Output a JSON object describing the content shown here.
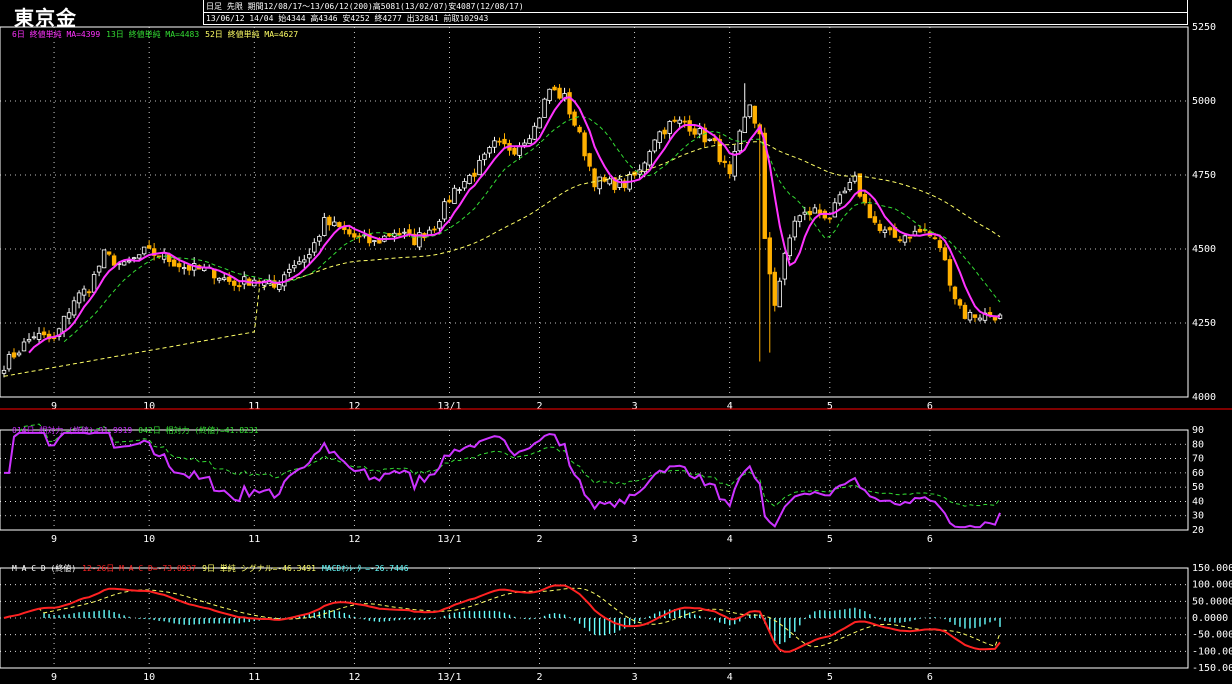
{
  "header": {
    "title": "東京金",
    "info_line1": "日足 先限 期間12/08/17～13/06/12(200)高5081(13/02/07)安4087(12/08/17)",
    "info_line2": "13/06/12 14/04 始4344 高4346 安4252 終4277 出32841 前取102943"
  },
  "colors": {
    "background": "#000000",
    "candle_up": "#ffffff",
    "candle_down": "#ffb000",
    "ma6": "#ff33ff",
    "ma13": "#33dd33",
    "ma52": "#ffff66",
    "rsi14": "#cc33ff",
    "rsi42": "#33dd33",
    "macd": "#ff2222",
    "signal": "#ffff66",
    "oscillator": "#66ffff",
    "grid": "#ffffff",
    "separator": "#ff0000"
  },
  "legends": {
    "price": [
      {
        "text": "6日 終値単純 MA=4399",
        "color": "#ff33ff"
      },
      {
        "text": "13日 終値単純 MA=4483",
        "color": "#33dd33"
      },
      {
        "text": "52日 終値単純 MA=4627",
        "color": "#ffff66"
      }
    ],
    "rsi": [
      {
        "text": "014日 相対力 (終値)=31.9919",
        "color": "#cc33ff"
      },
      {
        "text": "042日 相対力 (終値)=41.8231",
        "color": "#33dd33"
      }
    ],
    "macd": [
      {
        "text": "M A C D (終値)",
        "color": "#ffffff"
      },
      {
        "text": "12-26日 M A C D=-73.0937",
        "color": "#ff2222"
      },
      {
        "text": "9日 単純 シグナル=-46.3491",
        "color": "#ffff66"
      },
      {
        "text": "MACDｵｼﾚｰﾀｰ=-26.7446",
        "color": "#66ffff"
      }
    ]
  },
  "chart_data": [
    {
      "type": "candlestick",
      "title": "東京金",
      "ylim": [
        4000,
        5250
      ],
      "y_ticks": [
        4000,
        4250,
        4500,
        4750,
        5000,
        5250
      ],
      "y_tick_labels": [
        "4000",
        "4250",
        "4500",
        "4750",
        "5000",
        "5250"
      ],
      "x_tick_labels": [
        "9",
        "10",
        "11",
        "12",
        "13/1",
        "2",
        "3",
        "4",
        "5",
        "6"
      ],
      "x_tick_index": [
        10,
        29,
        50,
        70,
        89,
        107,
        126,
        145,
        165,
        185
      ],
      "grid": true,
      "n_days": 200,
      "close_keypoints": [
        [
          0,
          4110
        ],
        [
          6,
          4210
        ],
        [
          10,
          4190
        ],
        [
          14,
          4330
        ],
        [
          17,
          4370
        ],
        [
          20,
          4480
        ],
        [
          24,
          4440
        ],
        [
          28,
          4490
        ],
        [
          31,
          4480
        ],
        [
          36,
          4440
        ],
        [
          42,
          4420
        ],
        [
          46,
          4380
        ],
        [
          50,
          4400
        ],
        [
          54,
          4370
        ],
        [
          57,
          4440
        ],
        [
          61,
          4480
        ],
        [
          64,
          4590
        ],
        [
          67,
          4570
        ],
        [
          70,
          4540
        ],
        [
          74,
          4520
        ],
        [
          78,
          4560
        ],
        [
          82,
          4530
        ],
        [
          86,
          4580
        ],
        [
          90,
          4700
        ],
        [
          94,
          4760
        ],
        [
          98,
          4850
        ],
        [
          102,
          4840
        ],
        [
          106,
          4910
        ],
        [
          109,
          5040
        ],
        [
          112,
          5010
        ],
        [
          115,
          4880
        ],
        [
          118,
          4730
        ],
        [
          121,
          4720
        ],
        [
          124,
          4720
        ],
        [
          127,
          4760
        ],
        [
          130,
          4880
        ],
        [
          133,
          4920
        ],
        [
          136,
          4930
        ],
        [
          139,
          4890
        ],
        [
          142,
          4850
        ],
        [
          145,
          4740
        ],
        [
          147,
          4880
        ],
        [
          149,
          4990
        ],
        [
          151,
          4880
        ],
        [
          152,
          4520
        ],
        [
          154,
          4320
        ],
        [
          156,
          4470
        ],
        [
          158,
          4600
        ],
        [
          162,
          4630
        ],
        [
          165,
          4610
        ],
        [
          168,
          4690
        ],
        [
          170,
          4730
        ],
        [
          172,
          4650
        ],
        [
          175,
          4560
        ],
        [
          178,
          4540
        ],
        [
          181,
          4550
        ],
        [
          184,
          4560
        ],
        [
          187,
          4510
        ],
        [
          190,
          4340
        ],
        [
          192,
          4277
        ]
      ],
      "final_close": 4277,
      "ma_values": {
        "ma6": 4399,
        "ma13": 4483,
        "ma52": 4627
      }
    },
    {
      "type": "line",
      "title": "相対力",
      "ylim": [
        20,
        90
      ],
      "y_ticks": [
        20,
        30,
        40,
        50,
        60,
        70,
        80,
        90
      ],
      "y_tick_labels": [
        "20",
        "30",
        "40",
        "50",
        "60",
        "70",
        "80",
        "90"
      ],
      "x_tick_labels": [
        "9",
        "10",
        "11",
        "12",
        "13/1",
        "2",
        "3",
        "4",
        "5",
        "6"
      ],
      "series": [
        {
          "name": "014日 相対力 (終値)",
          "final": 31.9919
        },
        {
          "name": "042日 相対力 (終値)",
          "final": 41.8231
        }
      ]
    },
    {
      "type": "line",
      "title": "M A C D (終値)",
      "ylim": [
        -150,
        150
      ],
      "y_ticks": [
        -150,
        -100,
        -50,
        0,
        50,
        100,
        150
      ],
      "y_tick_labels": [
        "-150.0000",
        "-100.0000",
        "-50.0000",
        "0.0000",
        "50.0000",
        "100.0000",
        "150.0000"
      ],
      "x_tick_labels": [
        "9",
        "10",
        "11",
        "12",
        "13/1",
        "2",
        "3",
        "4",
        "5",
        "6"
      ],
      "series": [
        {
          "name": "12-26日 M A C D",
          "final": -73.0937
        },
        {
          "name": "9日 単純 シグナル",
          "final": -46.3491
        },
        {
          "name": "MACDｵｼﾚｰﾀｰ",
          "final": -26.7446
        }
      ]
    }
  ]
}
